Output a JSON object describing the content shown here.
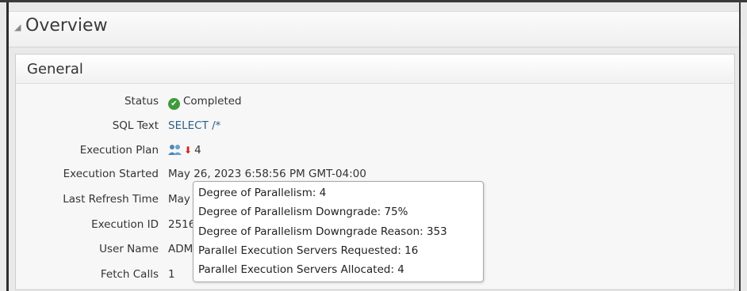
{
  "overview": {
    "title": "Overview"
  },
  "general": {
    "title": "General",
    "rows": [
      {
        "label": "Status",
        "value": "Completed"
      },
      {
        "label": "SQL Text",
        "value": "SELECT /*"
      },
      {
        "label": "Execution Plan",
        "value": "4"
      },
      {
        "label": "Execution Started",
        "value": "May 26, 2023 6:58:56 PM GMT-04:00"
      },
      {
        "label": "Last Refresh Time",
        "value": "May"
      },
      {
        "label": "Execution ID",
        "value": "2516"
      },
      {
        "label": "User Name",
        "value": "ADM"
      },
      {
        "label": "Fetch Calls",
        "value": "1"
      }
    ]
  },
  "tooltip": {
    "lines": [
      "Degree of Parallelism: 4",
      "Degree of Parallelism Downgrade: 75%",
      "Degree of Parallelism Downgrade Reason: 353",
      "Parallel Execution Servers Requested: 16",
      "Parallel Execution Servers Allocated: 4"
    ]
  },
  "icons": {
    "status": "check-circle-icon",
    "plan": "parallel-users-icon",
    "downgrade": "down-arrow-icon"
  },
  "colors": {
    "status_ok": "#3e9a3b",
    "link": "#2d5f86",
    "downgrade_arrow": "#d41f1f"
  }
}
